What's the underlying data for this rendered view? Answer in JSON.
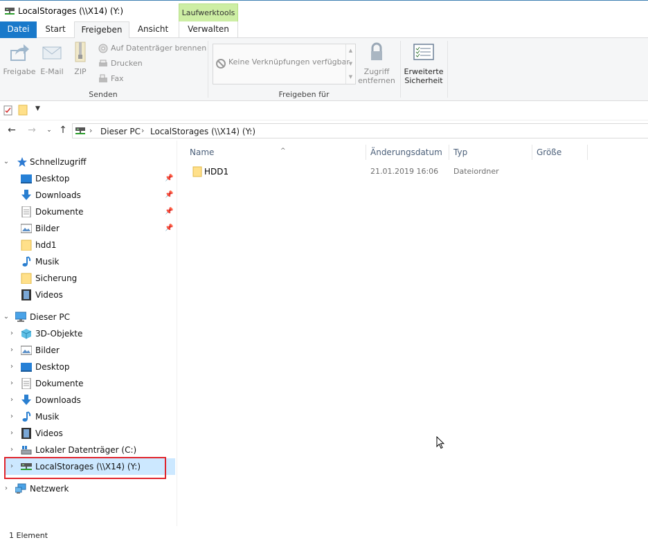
{
  "window": {
    "title": "LocalStorages (\\\\X14) (Y:)",
    "context_tab_header": "Laufwerktools"
  },
  "ribbon_tabs": [
    {
      "label": "Datei"
    },
    {
      "label": "Start"
    },
    {
      "label": "Freigeben"
    },
    {
      "label": "Ansicht"
    },
    {
      "label": "Verwalten"
    }
  ],
  "ribbon": {
    "send_group": {
      "label": "Senden",
      "share": "Freigabe",
      "email": "E-Mail",
      "zip": "ZIP",
      "burn": "Auf Datenträger brennen",
      "print": "Drucken",
      "fax": "Fax"
    },
    "share_with_group": {
      "label": "Freigeben für",
      "empty_text": "Keine Verknüpfungen verfügbar",
      "remove_access_line1": "Zugriff",
      "remove_access_line2": "entfernen"
    },
    "advanced_security_line1": "Erweiterte",
    "advanced_security_line2": "Sicherheit"
  },
  "breadcrumb": [
    "Dieser PC",
    "LocalStorages (\\\\X14) (Y:)"
  ],
  "nav": {
    "quick_access": "Schnellzugriff",
    "quick_items": [
      "Desktop",
      "Downloads",
      "Dokumente",
      "Bilder",
      "hdd1",
      "Musik",
      "Sicherung",
      "Videos"
    ],
    "this_pc": "Dieser PC",
    "pc_items": [
      "3D-Objekte",
      "Bilder",
      "Desktop",
      "Dokumente",
      "Downloads",
      "Musik",
      "Videos",
      "Lokaler Datenträger (C:)",
      "LocalStorages (\\\\X14) (Y:)"
    ],
    "network": "Netzwerk"
  },
  "columns": [
    "Name",
    "Änderungsdatum",
    "Typ",
    "Größe"
  ],
  "files": [
    {
      "name": "HDD1",
      "modified": "21.01.2019 16:06",
      "type": "Dateiordner",
      "size": ""
    }
  ],
  "status": "1 Element",
  "colors": {
    "accent": "#1979ca",
    "context_tab": "#cdeea4",
    "selection": "#cce8ff",
    "highlight": "#e0242c"
  }
}
